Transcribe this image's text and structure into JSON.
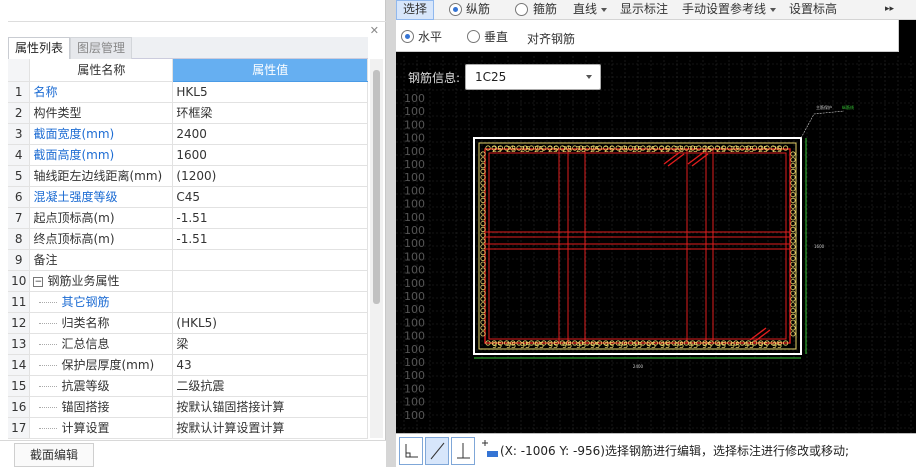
{
  "left_panel": {
    "tabs": [
      {
        "label": "属性列表"
      },
      {
        "label": "图层管理"
      }
    ],
    "columns": {
      "name": "属性名称",
      "value": "属性值"
    },
    "rows": [
      {
        "idx": "1",
        "name": "名称",
        "value": "HKL5",
        "blue": true
      },
      {
        "idx": "2",
        "name": "构件类型",
        "value": "环框梁"
      },
      {
        "idx": "3",
        "name": "截面宽度(mm)",
        "value": "2400",
        "blue": true
      },
      {
        "idx": "4",
        "name": "截面高度(mm)",
        "value": "1600",
        "blue": true
      },
      {
        "idx": "5",
        "name": "轴线距左边线距离(mm)",
        "value": "(1200)"
      },
      {
        "idx": "6",
        "name": "混凝土强度等级",
        "value": "C45",
        "blue": true
      },
      {
        "idx": "7",
        "name": "起点顶标高(m)",
        "value": "-1.51"
      },
      {
        "idx": "8",
        "name": "终点顶标高(m)",
        "value": "-1.51"
      },
      {
        "idx": "9",
        "name": "备注",
        "value": ""
      },
      {
        "idx": "10",
        "name": "钢筋业务属性",
        "value": "",
        "group": true
      },
      {
        "idx": "11",
        "name": "其它钢筋",
        "value": "",
        "child": true,
        "blue": true
      },
      {
        "idx": "12",
        "name": "归类名称",
        "value": "(HKL5)",
        "child": true
      },
      {
        "idx": "13",
        "name": "汇总信息",
        "value": "梁",
        "child": true
      },
      {
        "idx": "14",
        "name": "保护层厚度(mm)",
        "value": "43",
        "child": true
      },
      {
        "idx": "15",
        "name": "抗震等级",
        "value": "二级抗震",
        "child": true
      },
      {
        "idx": "16",
        "name": "锚固搭接",
        "value": "按默认锚固搭接计算",
        "child": true
      },
      {
        "idx": "17",
        "name": "计算设置",
        "value": "按默认计算设置计算",
        "child": true
      }
    ],
    "section_edit_button": "截面编辑"
  },
  "toolbar1": {
    "select": "选择",
    "longitudinal": "纵筋",
    "transverse": "箍筋",
    "line": "直线",
    "show_annotation": "显示标注",
    "manual_ref_line": "手动设置参考线",
    "set_elevation": "设置标高",
    "more": "▸▸"
  },
  "toolbar2": {
    "horizontal": "水平",
    "vertical": "垂直",
    "align_rebar": "对齐钢筋"
  },
  "rebar_info": {
    "label": "钢筋信息:",
    "value": "1C25"
  },
  "drawing": {
    "grid_label": "100",
    "bar_label": "25",
    "bottom_bar_label": "95",
    "dim_bottom": "2400",
    "dim_right": "1600",
    "corner_note_a": "主筋保护",
    "corner_note_b": "纵筋线"
  },
  "status": {
    "text": "(X: -1006 Y: -956)选择钢筋进行编辑，选择标注进行修改或移动;"
  },
  "colors": {
    "header_blue": "#66aff1",
    "rebar_red": "#e01e1e",
    "rebar_yellow": "#e8d36a",
    "accent": "#3574d4"
  }
}
